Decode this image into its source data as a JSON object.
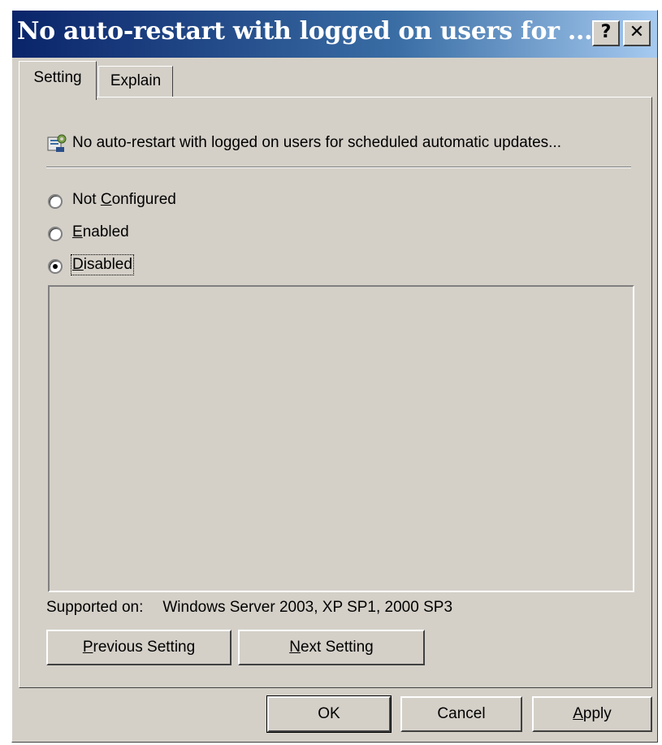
{
  "dialog": {
    "title": "No auto-restart with logged on users for ...",
    "help_label": "?",
    "close_label": "✕"
  },
  "tabs": [
    {
      "label": "Setting",
      "active": true
    },
    {
      "label": "Explain",
      "active": false
    }
  ],
  "policy": {
    "title": "No auto-restart with logged on users for scheduled automatic updates...",
    "icon": "policy-settings-icon"
  },
  "options": [
    {
      "label_pre": "Not ",
      "label_key": "C",
      "label_post": "onfigured",
      "selected": false
    },
    {
      "label_pre": "",
      "label_key": "E",
      "label_post": "nabled",
      "selected": false
    },
    {
      "label_pre": "",
      "label_key": "D",
      "label_post": "isabled",
      "selected": true
    }
  ],
  "supported": {
    "label": "Supported on:",
    "value": "Windows Server 2003, XP SP1, 2000 SP3"
  },
  "nav_buttons": {
    "previous": {
      "key": "P",
      "rest": "revious Setting"
    },
    "next": {
      "key": "N",
      "rest": "ext Setting"
    }
  },
  "footer_buttons": {
    "ok": "OK",
    "cancel": "Cancel",
    "apply": {
      "key": "A",
      "rest": "pply"
    }
  }
}
